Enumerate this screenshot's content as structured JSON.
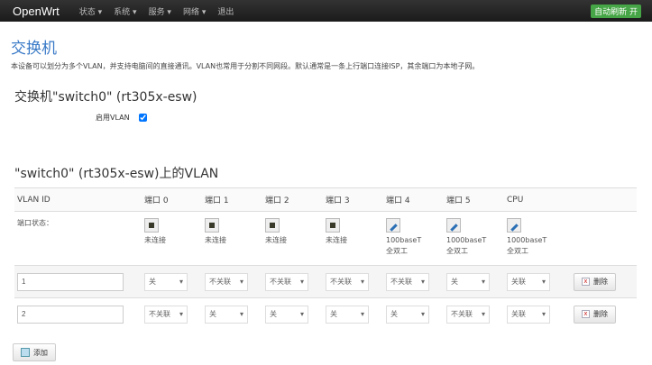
{
  "nav": {
    "brand": "OpenWrt",
    "menu": [
      "状态 ▾",
      "系统 ▾",
      "服务 ▾",
      "网络 ▾",
      "退出"
    ],
    "badge": "自动刷新 开"
  },
  "page": {
    "title": "交换机",
    "description": "本设备可以划分为多个VLAN，并支持电脑间的直接通讯。VLAN也常用于分割不同网段。默认通常是一条上行端口连接ISP，其余端口为本地子网。"
  },
  "switch": {
    "title": "交换机\"switch0\" (rt305x-esw)",
    "enable_vlan_label": "启用VLAN",
    "enable_vlan": true
  },
  "vlan": {
    "title": "\"switch0\" (rt305x-esw)上的VLAN",
    "headers": [
      "VLAN ID",
      "端口 0",
      "端口 1",
      "端口 2",
      "端口 3",
      "端口 4",
      "端口 5",
      "CPU"
    ],
    "status_label": "端口状态：",
    "ports": [
      {
        "icon": "port-disconnected-icon",
        "l1": "未连接",
        "l2": ""
      },
      {
        "icon": "port-disconnected-icon",
        "l1": "未连接",
        "l2": ""
      },
      {
        "icon": "port-disconnected-icon",
        "l1": "未连接",
        "l2": ""
      },
      {
        "icon": "port-disconnected-icon",
        "l1": "未连接",
        "l2": ""
      },
      {
        "icon": "port-connected-icon",
        "l1": "100baseT",
        "l2": "全双工"
      },
      {
        "icon": "port-connected-icon",
        "l1": "1000baseT",
        "l2": "全双工"
      },
      {
        "icon": "port-connected-icon",
        "l1": "1000baseT",
        "l2": "全双工"
      }
    ],
    "rows": [
      {
        "id": "1",
        "values": [
          "关",
          "不关联",
          "不关联",
          "不关联",
          "不关联",
          "关",
          "关联"
        ]
      },
      {
        "id": "2",
        "values": [
          "不关联",
          "关",
          "关",
          "关",
          "关",
          "不关联",
          "关联"
        ]
      }
    ],
    "delete_label": "删除",
    "add_label": "添加"
  }
}
